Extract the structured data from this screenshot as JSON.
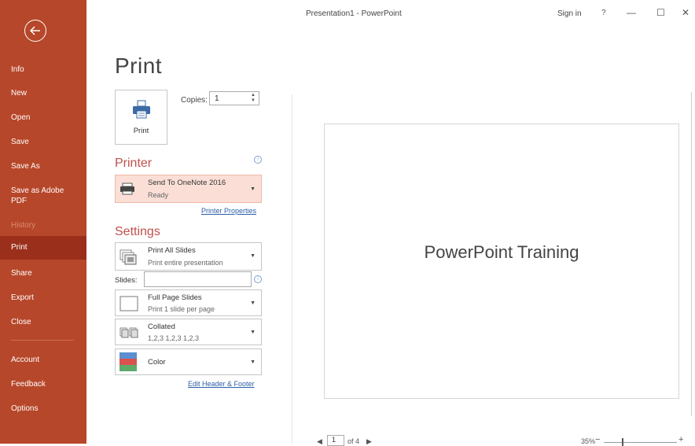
{
  "window": {
    "title": "Presentation1  -  PowerPoint",
    "sign_in": "Sign in",
    "help": "?",
    "minimize": "—",
    "maximize": "☐",
    "close": "✕"
  },
  "sidebar": {
    "items": [
      {
        "label": "Info"
      },
      {
        "label": "New"
      },
      {
        "label": "Open"
      },
      {
        "label": "Save"
      },
      {
        "label": "Save As"
      },
      {
        "label": "Save as Adobe PDF"
      },
      {
        "label": "History"
      },
      {
        "label": "Print"
      },
      {
        "label": "Share"
      },
      {
        "label": "Export"
      },
      {
        "label": "Close"
      },
      {
        "label": "Account"
      },
      {
        "label": "Feedback"
      },
      {
        "label": "Options"
      }
    ]
  },
  "print": {
    "title": "Print",
    "button_label": "Print",
    "copies_label": "Copies:",
    "copies_value": "1"
  },
  "printer": {
    "heading": "Printer",
    "name": "Send To OneNote 2016",
    "status": "Ready",
    "properties_link": "Printer Properties"
  },
  "settings": {
    "heading": "Settings",
    "slides_range": {
      "main": "Print All Slides",
      "sub": "Print entire presentation"
    },
    "slides_label": "Slides:",
    "slides_value": "",
    "layout": {
      "main": "Full Page Slides",
      "sub": "Print 1 slide per page"
    },
    "collation": {
      "main": "Collated",
      "sub": "1,2,3   1,2,3   1,2,3"
    },
    "color": {
      "main": "Color"
    },
    "header_footer_link": "Edit Header & Footer"
  },
  "preview": {
    "slide_title": "PowerPoint Training",
    "page_current": "1",
    "page_total": "of 4",
    "zoom": "35%",
    "zoom_level": 0.35
  },
  "colors": {
    "sidebar": "#b7472a",
    "sidebar_active": "#9a2f1b",
    "accent": "#c0504d",
    "link": "#2e5ea8"
  }
}
